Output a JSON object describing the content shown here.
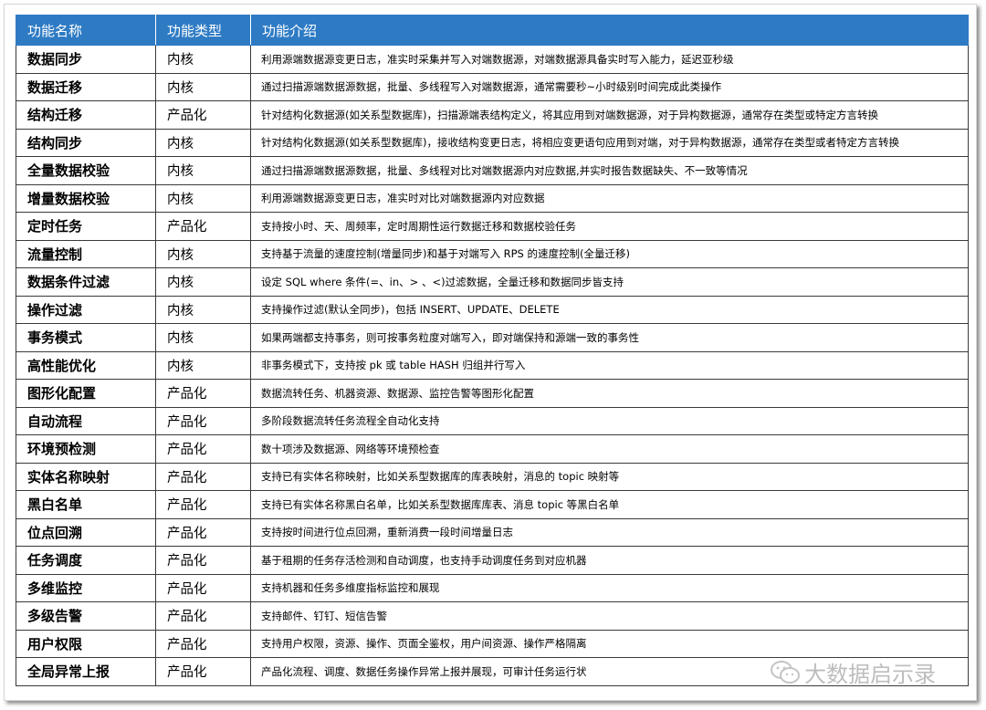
{
  "headers": [
    "功能名称",
    "功能类型",
    "功能介绍"
  ],
  "rows": [
    {
      "name": "数据同步",
      "type": "内核",
      "desc": "利用源端数据源变更日志，准实时采集并写入对端数据源，对端数据源具备实时写入能力，延迟亚秒级"
    },
    {
      "name": "数据迁移",
      "type": "内核",
      "desc": "通过扫描源端数据源数据，批量、多线程写入对端数据源，通常需要秒~小时级别时间完成此类操作"
    },
    {
      "name": "结构迁移",
      "type": "产品化",
      "desc": "针对结构化数据源(如关系型数据库)，扫描源端表结构定义，将其应用到对端数据源，对于异构数据源，通常存在类型或特定方言转换"
    },
    {
      "name": "结构同步",
      "type": "内核",
      "desc": "针对结构化数据源(如关系型数据库)，接收结构变更日志，将相应变更语句应用到对端，对于异构数据源，通常存在类型或者特定方言转换"
    },
    {
      "name": "全量数据校验",
      "type": "内核",
      "desc": "通过扫描源端数据源数据，批量、多线程对比对端数据源内对应数据,并实时报告数据缺失、不一致等情况"
    },
    {
      "name": "增量数据校验",
      "type": "内核",
      "desc": "利用源端数据源变更日志，准实时对比对端数据源内对应数据"
    },
    {
      "name": "定时任务",
      "type": "产品化",
      "desc": "支持按小时、天、周频率，定时周期性运行数据迁移和数据校验任务"
    },
    {
      "name": "流量控制",
      "type": "内核",
      "desc": "支持基于流量的速度控制(增量同步)和基于对端写入 RPS 的速度控制(全量迁移)"
    },
    {
      "name": "数据条件过滤",
      "type": "内核",
      "desc": "设定 SQL where 条件(=、in、> 、<)过滤数据，全量迁移和数据同步皆支持"
    },
    {
      "name": "操作过滤",
      "type": "内核",
      "desc": "支持操作过滤(默认全同步)，包括 INSERT、UPDATE、DELETE"
    },
    {
      "name": "事务模式",
      "type": "内核",
      "desc": "如果两端都支持事务，则可按事务粒度对端写入，即对端保持和源端一致的事务性"
    },
    {
      "name": "高性能优化",
      "type": "内核",
      "desc": "非事务模式下，支持按 pk 或 table HASH 归组并行写入"
    },
    {
      "name": "图形化配置",
      "type": "产品化",
      "desc": "数据流转任务、机器资源、数据源、监控告警等图形化配置"
    },
    {
      "name": "自动流程",
      "type": "产品化",
      "desc": "多阶段数据流转任务流程全自动化支持"
    },
    {
      "name": "环境预检测",
      "type": "产品化",
      "desc": "数十项涉及数据源、网络等环境预检查"
    },
    {
      "name": "实体名称映射",
      "type": "产品化",
      "desc": "支持已有实体名称映射，比如关系型数据库的库表映射，消息的 topic 映射等"
    },
    {
      "name": "黑白名单",
      "type": "产品化",
      "desc": "支持已有实体名称黑白名单，比如关系型数据库库表、消息 topic 等黑白名单"
    },
    {
      "name": "位点回溯",
      "type": "产品化",
      "desc": "支持按时间进行位点回溯，重新消费一段时间增量日志"
    },
    {
      "name": "任务调度",
      "type": "产品化",
      "desc": "基于租期的任务存活检测和自动调度，也支持手动调度任务到对应机器"
    },
    {
      "name": "多维监控",
      "type": "产品化",
      "desc": "支持机器和任务多维度指标监控和展现"
    },
    {
      "name": "多级告警",
      "type": "产品化",
      "desc": "支持邮件、钉钉、短信告警"
    },
    {
      "name": "用户权限",
      "type": "产品化",
      "desc": "支持用户权限，资源、操作、页面全鉴权，用户间资源、操作严格隔离"
    },
    {
      "name": "全局异常上报",
      "type": "产品化",
      "desc": "产品化流程、调度、数据任务操作异常上报并展现，可审计任务运行状"
    }
  ],
  "watermark": {
    "text": "大数据启示录",
    "icon": "wechat-icon"
  },
  "colors": {
    "header_bg": "#2e7bc4",
    "header_text": "#ffffff",
    "border": "#3a3a3a"
  }
}
